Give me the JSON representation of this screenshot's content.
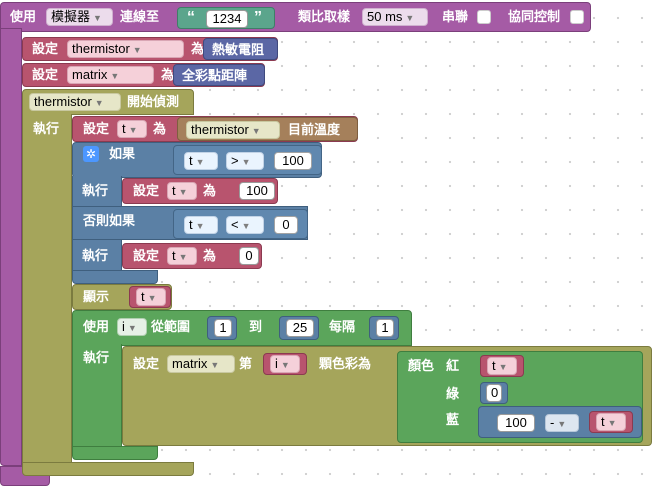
{
  "workspace": {
    "setup": {
      "use_label": "使用",
      "device": "模擬器",
      "connect_label": "連線至",
      "quote_open": "“",
      "address": "1234",
      "quote_close": "”",
      "sample_label": "類比取樣",
      "sample_rate": "50 ms",
      "serial_label": "串聯",
      "protocol_label": "協同控制"
    },
    "set_thermistor": {
      "set_label": "設定",
      "variable": "thermistor",
      "to_label": "為",
      "value": "熱敏電阻"
    },
    "set_matrix": {
      "set_label": "設定",
      "variable": "matrix",
      "to_label": "為",
      "value": "全彩點距陣"
    },
    "thermistor_event": {
      "device": "thermistor",
      "event_label": "開始偵測",
      "do_label": "執行"
    },
    "set_t": {
      "set_label": "設定",
      "variable": "t",
      "to_label": "為",
      "device": "thermistor",
      "property": "目前溫度"
    },
    "if_block": {
      "if_label": "如果",
      "cond1": {
        "var": "t",
        "op": ">",
        "value": "100"
      },
      "do1_label": "執行",
      "do1": {
        "set_label": "設定",
        "variable": "t",
        "to_label": "為",
        "value": "100"
      },
      "elseif_label": "否則如果",
      "cond2": {
        "var": "t",
        "op": "<",
        "value": "0"
      },
      "do2_label": "執行",
      "do2": {
        "set_label": "設定",
        "variable": "t",
        "to_label": "為",
        "value": "0"
      }
    },
    "print": {
      "label": "顯示",
      "variable": "t"
    },
    "loop": {
      "use_label": "使用",
      "var": "i",
      "from_label": "從範圍",
      "from": "1",
      "to_label": "到",
      "to": "25",
      "step_label": "每隔",
      "step": "1",
      "do_label": "執行"
    },
    "matrix_set": {
      "set_label": "設定",
      "device": "matrix",
      "nth_label": "第",
      "index_var": "i",
      "color_label": "顆色彩為",
      "color_block_label": "顏色",
      "red_label": "紅",
      "red_var": "t",
      "green_label": "綠",
      "green_value": "0",
      "blue_label": "藍",
      "blue_num": "100",
      "blue_op": "-",
      "blue_var": "t"
    }
  },
  "colors": {
    "purple": "#a55ba5",
    "red": "#b8546e",
    "olive": "#a5a55b",
    "blue": "#5b80a5",
    "green": "#5ba55b",
    "brown": "#a5805b",
    "indigo": "#5b67a5"
  }
}
